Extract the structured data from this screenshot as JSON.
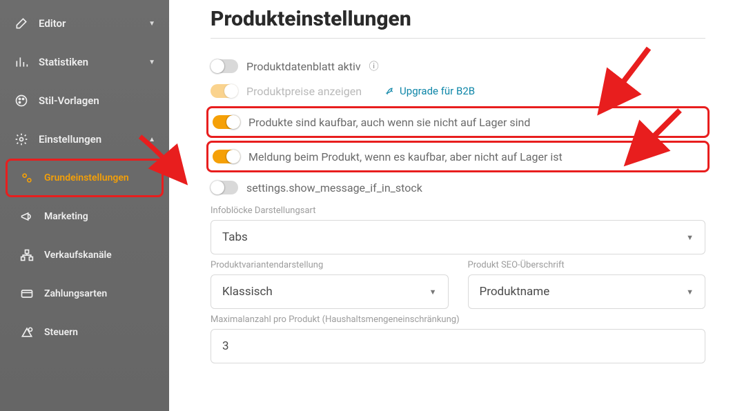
{
  "sidebar": {
    "items": [
      {
        "label": "Editor",
        "icon": "edit",
        "expandable": true,
        "expanded": false
      },
      {
        "label": "Statistiken",
        "icon": "stats",
        "expandable": true,
        "expanded": false
      },
      {
        "label": "Stil-Vorlagen",
        "icon": "palette",
        "expandable": false
      },
      {
        "label": "Einstellungen",
        "icon": "gear",
        "expandable": true,
        "expanded": true
      },
      {
        "label": "Grundeinstellungen",
        "icon": "gears",
        "sub": true,
        "active": true
      },
      {
        "label": "Marketing",
        "icon": "megaphone",
        "sub": true
      },
      {
        "label": "Verkaufskanäle",
        "icon": "channels",
        "sub": true
      },
      {
        "label": "Zahlungsarten",
        "icon": "card",
        "sub": true
      },
      {
        "label": "Steuern",
        "icon": "tax",
        "sub": true
      }
    ]
  },
  "page": {
    "title": "Produkteinstellungen"
  },
  "toggles": {
    "datasheet_label": "Produktdatenblatt aktiv",
    "prices_label": "Produktpreise anzeigen",
    "buyable_label": "Produkte sind kaufbar, auch wenn sie nicht auf Lager sind",
    "oos_msg_label": "Meldung beim Produkt, wenn es kaufbar, aber nicht auf Lager ist",
    "in_stock_label": "settings.show_message_if_in_stock"
  },
  "upgrade_text": "Upgrade für B2B",
  "fields": {
    "infoblocks_label": "Infoblöcke Darstellungsart",
    "infoblocks_value": "Tabs",
    "variant_label": "Produktvariantendarstellung",
    "variant_value": "Klassisch",
    "seo_label": "Produkt SEO-Überschrift",
    "seo_value": "Produktname",
    "maxqty_label": "Maximalanzahl pro Produkt (Haushaltsmengeneinschränkung)",
    "maxqty_value": "3"
  }
}
